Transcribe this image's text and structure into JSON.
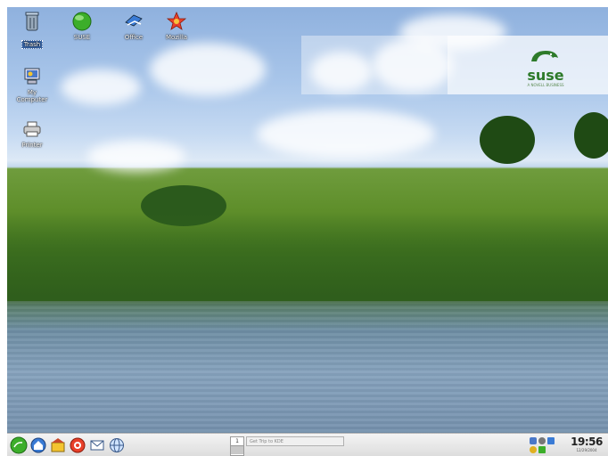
{
  "desktop": {
    "icons": [
      {
        "id": "trash",
        "label": "Trash",
        "glyph": "trash-icon"
      },
      {
        "id": "suse",
        "label": "SUSE",
        "glyph": "suse-globe-icon"
      },
      {
        "id": "office",
        "label": "Office",
        "glyph": "office-icon"
      },
      {
        "id": "mozilla",
        "label": "Mozilla",
        "glyph": "mozilla-icon"
      },
      {
        "id": "mycomputer",
        "label": "My\nComputer",
        "glyph": "computer-icon"
      },
      {
        "id": "printer",
        "label": "Printer",
        "glyph": "printer-icon"
      }
    ],
    "logo": {
      "word": "suse",
      "tagline": "A NOVELL BUSINESS"
    }
  },
  "taskbar": {
    "launchers": [
      "kmenu-icon",
      "home-icon",
      "konqueror-icon",
      "help-icon",
      "mail-icon",
      "web-browser-icon"
    ],
    "pager": {
      "desktop_number": "1"
    },
    "task_entry": "Get Trip to KDE",
    "tray": [
      "network-icon",
      "volume-icon",
      "monitor-icon",
      "update-icon",
      "keyboard-icon"
    ],
    "clock": {
      "time": "19:56",
      "date": "12/29/2004"
    }
  },
  "colors": {
    "sky": "#a9c6ea",
    "grass": "#4a7d22",
    "water": "#7591ad",
    "taskbar": "#e4e4e4",
    "suse_green": "#2d7a2a"
  }
}
